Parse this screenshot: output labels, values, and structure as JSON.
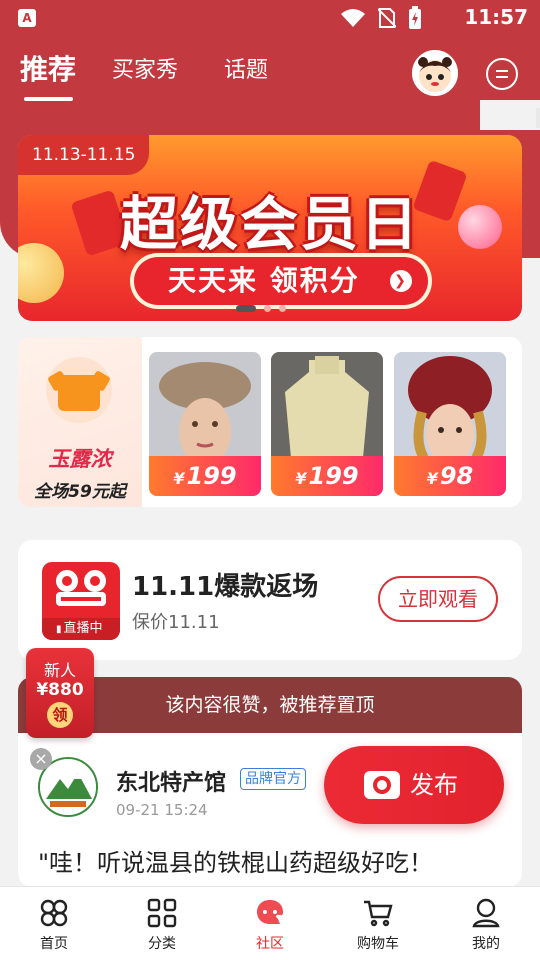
{
  "status_bar": {
    "app_icon": "A",
    "time": "11:57"
  },
  "top_nav": {
    "tabs": [
      {
        "label": "推荐",
        "active": true
      },
      {
        "label": "买家秀",
        "active": false
      },
      {
        "label": "话题",
        "active": false
      }
    ]
  },
  "banner": {
    "date_range": "11.13-11.15",
    "title": "超级会员日",
    "button_text": "天天来  领积分",
    "dots": 3,
    "active_dot": 0
  },
  "promo": {
    "brand": "玉露浓",
    "brand_subtitle": "全场59元起",
    "products": [
      {
        "currency": "¥",
        "price": "199",
        "image": "fur-hat-woman"
      },
      {
        "currency": "¥",
        "price": "199",
        "image": "cream-turtleneck-sweater"
      },
      {
        "currency": "¥",
        "price": "98",
        "image": "red-knit-hat-woman"
      }
    ]
  },
  "live_card": {
    "title": "11.11爆款返场",
    "subtitle": "保价11.11",
    "badge": "直播中",
    "button": "立即观看"
  },
  "newcomer": {
    "line1": "新人",
    "line2": "¥880",
    "line3": "领"
  },
  "post": {
    "pinned_notice": "该内容很赞，被推荐置顶",
    "shop_name": "东北特产馆",
    "shop_tag": "品牌官方",
    "time": "09-21 15:24",
    "text": "\"哇！听说温县的铁棍山药超级好吃！",
    "close_label": "×"
  },
  "publish_button": {
    "label": "发布"
  },
  "bottom_nav": {
    "items": [
      {
        "label": "首页",
        "icon": "home-icon",
        "active": false
      },
      {
        "label": "分类",
        "icon": "category-icon",
        "active": false
      },
      {
        "label": "社区",
        "icon": "community-icon",
        "active": true
      },
      {
        "label": "购物车",
        "icon": "cart-icon",
        "active": false
      },
      {
        "label": "我的",
        "icon": "profile-icon",
        "active": false
      }
    ]
  },
  "colors": {
    "brand_red": "#c23a40",
    "accent_red": "#e8252c",
    "pinned_bg": "#8c3b3b"
  }
}
